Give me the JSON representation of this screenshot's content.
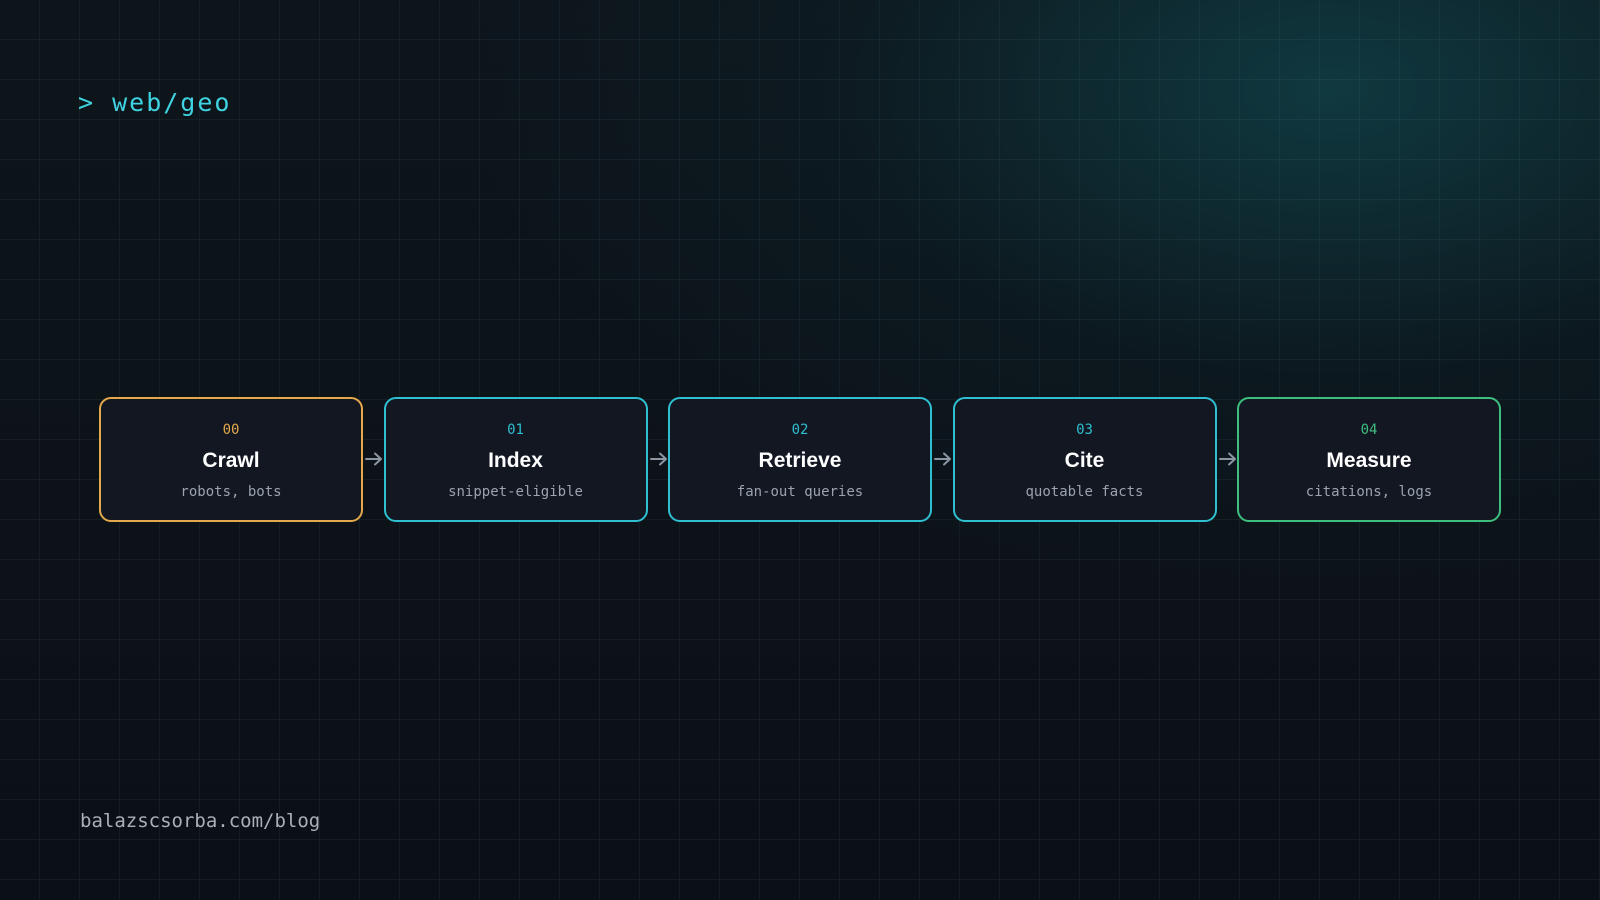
{
  "header": {
    "prompt": "> web/geo"
  },
  "pipeline": {
    "steps": [
      {
        "num": "00",
        "title": "Crawl",
        "subtitle": "robots, bots",
        "color": "#e3a94a"
      },
      {
        "num": "01",
        "title": "Index",
        "subtitle": "snippet-eligible",
        "color": "#2fbfd0"
      },
      {
        "num": "02",
        "title": "Retrieve",
        "subtitle": "fan-out queries",
        "color": "#2fbfd0"
      },
      {
        "num": "03",
        "title": "Cite",
        "subtitle": "quotable facts",
        "color": "#2fbfd0"
      },
      {
        "num": "04",
        "title": "Measure",
        "subtitle": "citations, logs",
        "color": "#3fbf7f"
      }
    ],
    "arrow_icon": "arrow-right-icon",
    "arrow_color": "#8a96a3",
    "node_background": "#121722"
  },
  "footer": {
    "url": "balazscsorba.com/blog"
  }
}
